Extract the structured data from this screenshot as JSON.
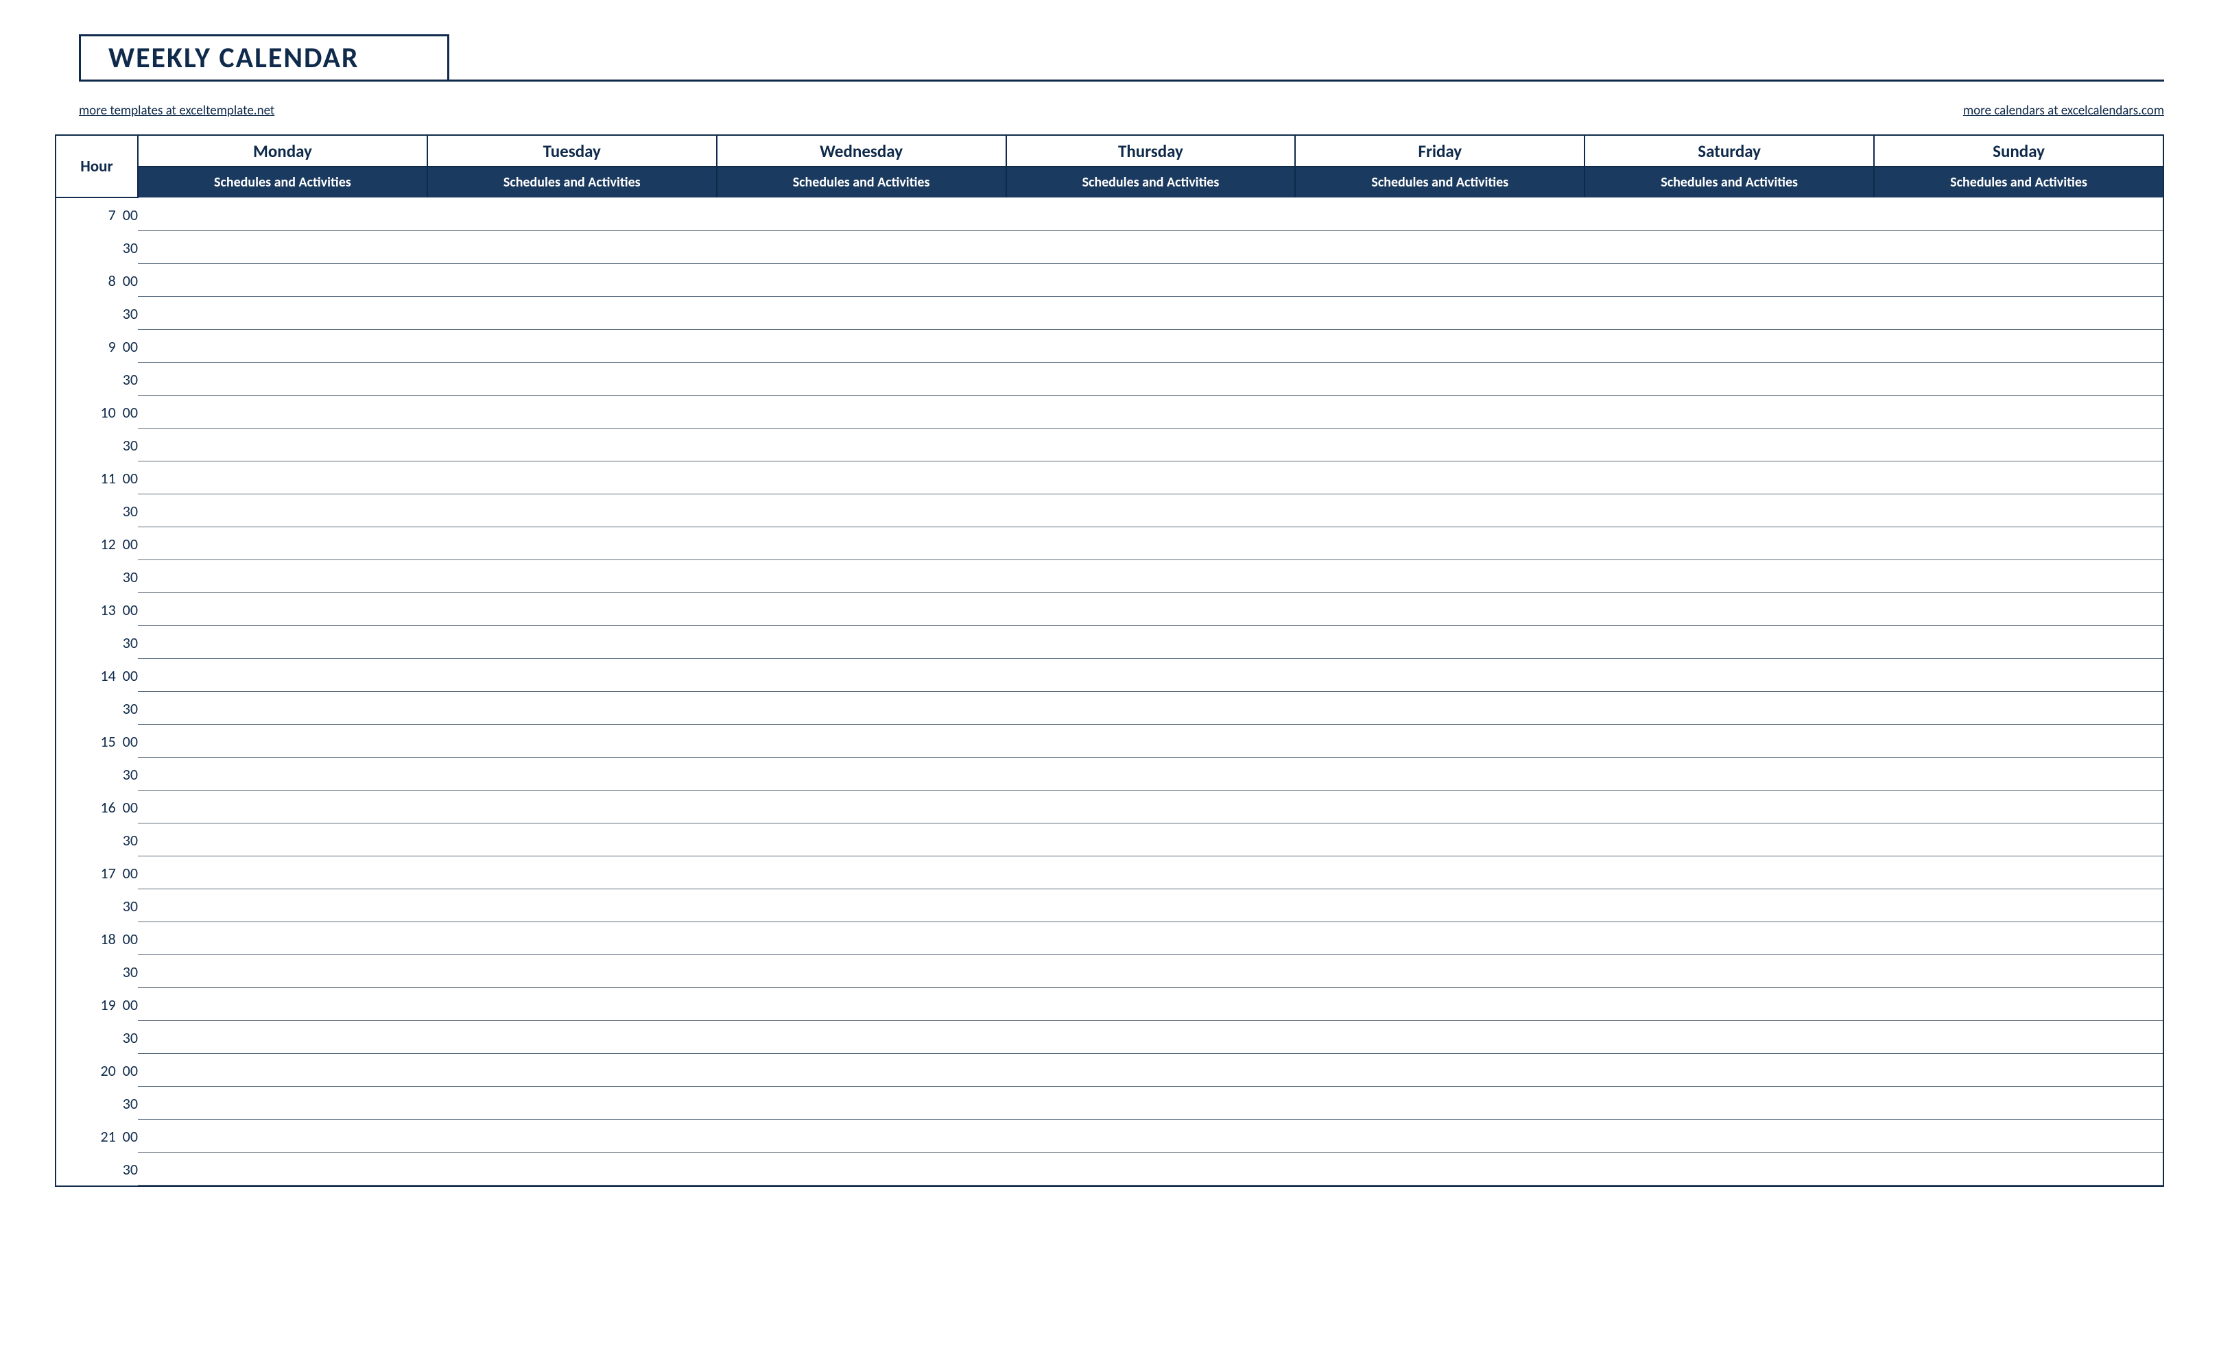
{
  "title": "WEEKLY CALENDAR",
  "links": {
    "left": "more templates at exceltemplate.net",
    "right": "more calendars at excelcalendars.com"
  },
  "headers": {
    "hour": "Hour",
    "days": [
      "Monday",
      "Tuesday",
      "Wednesday",
      "Thursday",
      "Friday",
      "Saturday",
      "Sunday"
    ],
    "sub": "Schedules and Activities"
  },
  "hours": [
    {
      "h": "7",
      "m": "00"
    },
    {
      "h": "",
      "m": "30"
    },
    {
      "h": "8",
      "m": "00"
    },
    {
      "h": "",
      "m": "30"
    },
    {
      "h": "9",
      "m": "00"
    },
    {
      "h": "",
      "m": "30"
    },
    {
      "h": "10",
      "m": "00"
    },
    {
      "h": "",
      "m": "30"
    },
    {
      "h": "11",
      "m": "00"
    },
    {
      "h": "",
      "m": "30"
    },
    {
      "h": "12",
      "m": "00"
    },
    {
      "h": "",
      "m": "30"
    },
    {
      "h": "13",
      "m": "00"
    },
    {
      "h": "",
      "m": "30"
    },
    {
      "h": "14",
      "m": "00"
    },
    {
      "h": "",
      "m": "30"
    },
    {
      "h": "15",
      "m": "00"
    },
    {
      "h": "",
      "m": "30"
    },
    {
      "h": "16",
      "m": "00"
    },
    {
      "h": "",
      "m": "30"
    },
    {
      "h": "17",
      "m": "00"
    },
    {
      "h": "",
      "m": "30"
    },
    {
      "h": "18",
      "m": "00"
    },
    {
      "h": "",
      "m": "30"
    },
    {
      "h": "19",
      "m": "00"
    },
    {
      "h": "",
      "m": "30"
    },
    {
      "h": "20",
      "m": "00"
    },
    {
      "h": "",
      "m": "30"
    },
    {
      "h": "21",
      "m": "00"
    },
    {
      "h": "",
      "m": "30"
    }
  ]
}
